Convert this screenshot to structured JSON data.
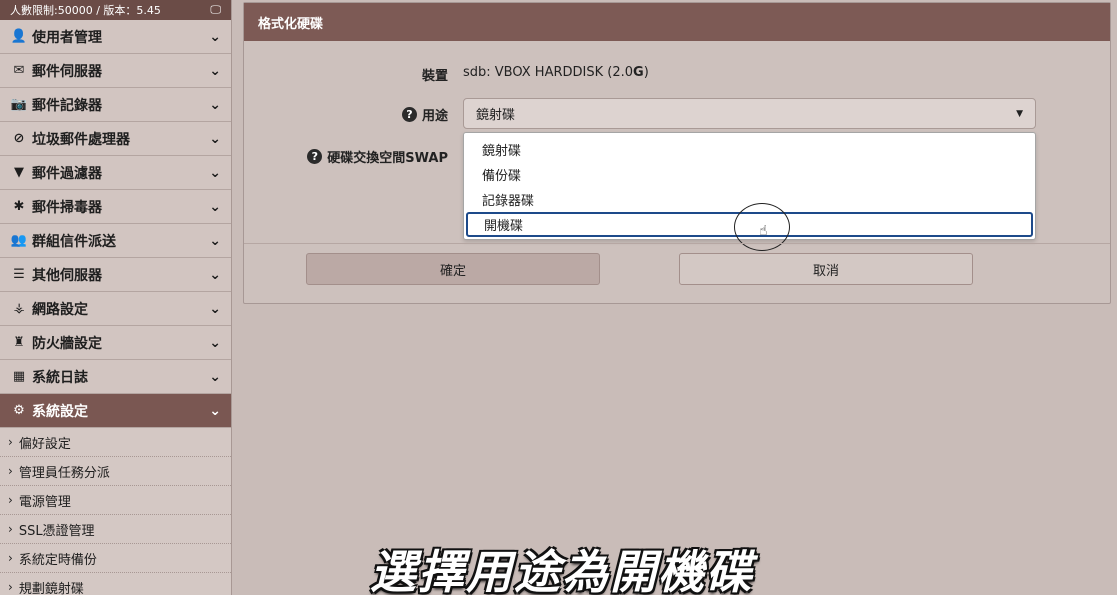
{
  "top_bar": {
    "info": "人數限制:50000 / 版本：5.45",
    "monitor_icon": "monitor-icon"
  },
  "sidebar": {
    "items": [
      {
        "label": "使用者管理",
        "icon": "user-icon",
        "glyph": "👤"
      },
      {
        "label": "郵件伺服器",
        "icon": "envelope-icon",
        "glyph": "✉"
      },
      {
        "label": "郵件記錄器",
        "icon": "camera-icon",
        "glyph": "📷"
      },
      {
        "label": "垃圾郵件處理器",
        "icon": "ban-icon",
        "glyph": "⊘"
      },
      {
        "label": "郵件過濾器",
        "icon": "filter-icon",
        "glyph": "▼"
      },
      {
        "label": "郵件掃毒器",
        "icon": "bug-icon",
        "glyph": "✱"
      },
      {
        "label": "群組信件派送",
        "icon": "group-icon",
        "glyph": "👥"
      },
      {
        "label": "其他伺服器",
        "icon": "server-icon",
        "glyph": "☰"
      },
      {
        "label": "網路設定",
        "icon": "network-icon",
        "glyph": "⚶"
      },
      {
        "label": "防火牆設定",
        "icon": "firewall-icon",
        "glyph": "♜"
      },
      {
        "label": "系統日誌",
        "icon": "film-icon",
        "glyph": "▦"
      },
      {
        "label": "系統設定",
        "icon": "gears-icon",
        "glyph": "⚙"
      }
    ],
    "sub_items": [
      {
        "label": "偏好設定"
      },
      {
        "label": "管理員任務分派"
      },
      {
        "label": "電源管理"
      },
      {
        "label": "SSL憑證管理"
      },
      {
        "label": "系統定時備份"
      },
      {
        "label": "規劃鏡射碟"
      }
    ]
  },
  "panel": {
    "title": "格式化硬碟",
    "device_label": "裝置",
    "device_value_prefix": "sdb: VBOX HARDDISK (2.0",
    "device_value_bold": "G",
    "device_value_suffix": ")",
    "purpose_label": "用途",
    "swap_label": "硬碟交換空間SWAP",
    "select_value": "鏡射碟",
    "options": [
      "鏡射碟",
      "備份碟",
      "記錄器碟",
      "開機碟"
    ],
    "highlighted_option": "開機碟",
    "ok_button": "確定",
    "cancel_button": "取消"
  },
  "caption": "選擇用途為開機碟",
  "colors": {
    "header": "#7d5a55",
    "active_menu": "#7a5752",
    "background": "#c9bcb8"
  }
}
